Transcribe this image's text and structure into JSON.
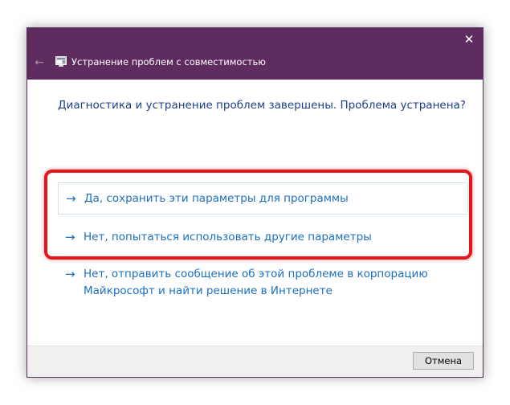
{
  "window": {
    "title": "Устранение проблем с совместимостью",
    "close_label": "✕",
    "back_label": "←"
  },
  "main": {
    "heading": "Диагностика и устранение проблем завершены. Проблема устранена?",
    "options": [
      {
        "label": "Да, сохранить эти параметры для программы"
      },
      {
        "label": "Нет, попытаться использовать другие параметры"
      },
      {
        "label": "Нет, отправить сообщение об этой проблеме в корпорацию Майкрософт и найти решение в Интернете"
      }
    ],
    "arrow_glyph": "→"
  },
  "footer": {
    "cancel_label": "Отмена"
  },
  "colors": {
    "titlebar": "#5f2c5f",
    "link": "#1a6fc0",
    "heading": "#1e3f88",
    "highlight": "#e8141b"
  }
}
